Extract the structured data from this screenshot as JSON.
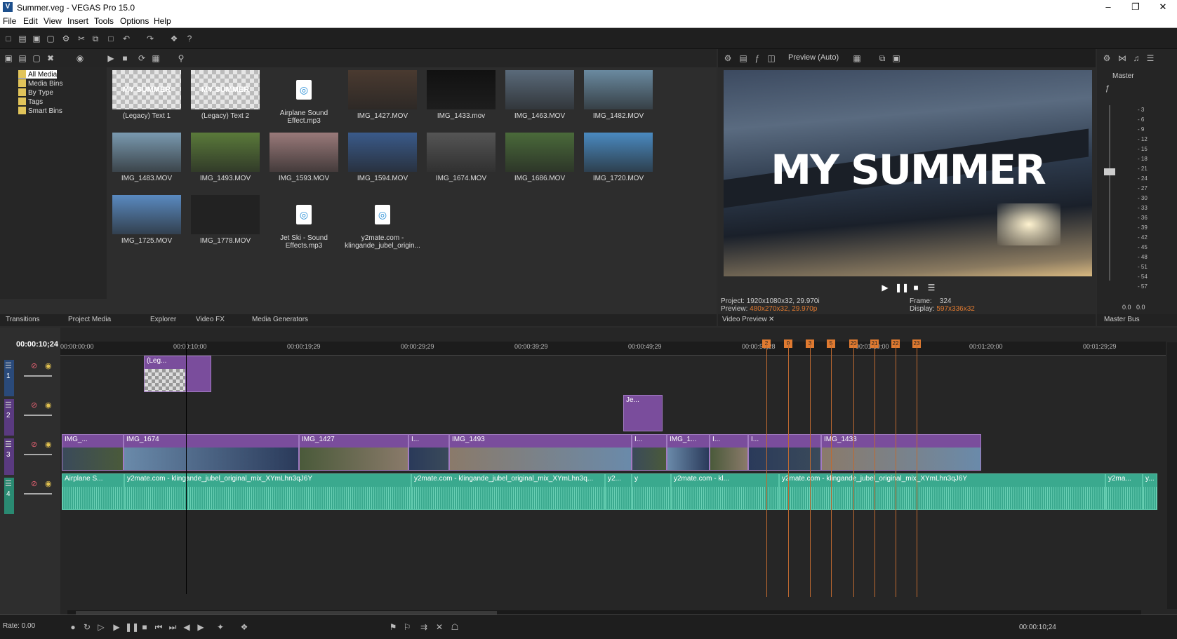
{
  "window": {
    "title": "Summer.veg - VEGAS Pro 15.0",
    "icon": "V"
  },
  "menu": [
    "File",
    "Edit",
    "View",
    "Insert",
    "Tools",
    "Options",
    "Help"
  ],
  "project_media": {
    "tree": [
      "All Media",
      "Media Bins",
      "By Type",
      "Tags",
      "Smart Bins"
    ],
    "items": [
      {
        "label": "(Legacy) Text 1",
        "kind": "text",
        "thumb": "MY SUMMER"
      },
      {
        "label": "(Legacy) Text 2",
        "kind": "text",
        "thumb": "MY SUMMER"
      },
      {
        "label": "Airplane Sound Effect.mp3",
        "kind": "audio"
      },
      {
        "label": "IMG_1427.MOV",
        "kind": "video",
        "color": "#4a3a30"
      },
      {
        "label": "IMG_1433.mov",
        "kind": "video",
        "color": "#111"
      },
      {
        "label": "IMG_1463.MOV",
        "kind": "video",
        "color": "#5a6a7a"
      },
      {
        "label": "IMG_1482.MOV",
        "kind": "video",
        "color": "#6a8aa0"
      },
      {
        "label": "IMG_1483.MOV",
        "kind": "video",
        "color": "#7a9ab0"
      },
      {
        "label": "IMG_1493.MOV",
        "kind": "video",
        "color": "#5a7a3a"
      },
      {
        "label": "IMG_1593.MOV",
        "kind": "video",
        "color": "#9a7a7a"
      },
      {
        "label": "IMG_1594.MOV",
        "kind": "video",
        "color": "#3a5a8a"
      },
      {
        "label": "IMG_1674.MOV",
        "kind": "video",
        "color": "#555"
      },
      {
        "label": "IMG_1686.MOV",
        "kind": "video",
        "color": "#4a6a3a"
      },
      {
        "label": "IMG_1720.MOV",
        "kind": "video",
        "color": "#4a8ac0"
      },
      {
        "label": "IMG_1725.MOV",
        "kind": "video",
        "color": "#5a8ac0"
      },
      {
        "label": "IMG_1778.MOV",
        "kind": "video",
        "color": "#222"
      },
      {
        "label": "Jet Ski - Sound Effects.mp3",
        "kind": "audio"
      },
      {
        "label": "y2mate.com - klingande_jubel_origin...",
        "kind": "audio"
      }
    ],
    "tabs": [
      "Transitions",
      "Project Media",
      "Explorer",
      "Video FX",
      "Media Generators"
    ]
  },
  "preview": {
    "mode": "Preview (Auto)",
    "overlay_text": "MY SUMMER",
    "project_label": "Project:",
    "project_value": "1920x1080x32, 29.970i",
    "preview_label": "Preview:",
    "preview_value": "480x270x32, 29.970p",
    "frame_label": "Frame:",
    "frame_value": "324",
    "display_label": "Display:",
    "display_value": "597x336x32",
    "tab": "Video Preview"
  },
  "master_bus": {
    "label": "Master",
    "scale": [
      "3",
      "6",
      "9",
      "12",
      "15",
      "18",
      "21",
      "24",
      "27",
      "30",
      "33",
      "36",
      "39",
      "42",
      "45",
      "48",
      "51",
      "54",
      "57"
    ],
    "readout_l": "0.0",
    "readout_r": "0.0",
    "tab": "Master Bus"
  },
  "timeline": {
    "timecode": "00:00:10;24",
    "ruler": [
      "00:00:00;00",
      "00:00:10;00",
      "00:00:19;29",
      "00:00:29;29",
      "00:00:39;29",
      "00:00:49;29",
      "00:00:59;28",
      "00:01:10;00",
      "00:01:20;00",
      "00:01:29;29"
    ],
    "markers": [
      "2",
      "9",
      "3",
      "5",
      "20",
      "21",
      "22",
      "23"
    ],
    "track1_events": [
      {
        "label": "(Leg..."
      }
    ],
    "track2_events": [
      {
        "label": "Je..."
      }
    ],
    "track3_events": [
      "IMG_...",
      "IMG_1674",
      "IMG_1427",
      "I...",
      "IMG_1493",
      "I...",
      "IMG_1...",
      "I...",
      "I...",
      "IMG_1433"
    ],
    "track4_events": [
      "Airplane S...",
      "y2mate.com - klingande_jubel_original_mix_XYmLhn3qJ6Y",
      "y2mate.com - klingande_jubel_original_mix_XYmLhn3q...",
      "y2...",
      "y",
      "y2mate.com - kl...",
      "y2mate.com - klingande_jubel_original_mix_XYmLhn3qJ6Y",
      "y2ma...",
      "y..."
    ],
    "track_numbers": [
      "1",
      "2",
      "3",
      "4"
    ]
  },
  "status": {
    "rate": "Rate: 0.00",
    "timecode": "00:00:10;24"
  }
}
